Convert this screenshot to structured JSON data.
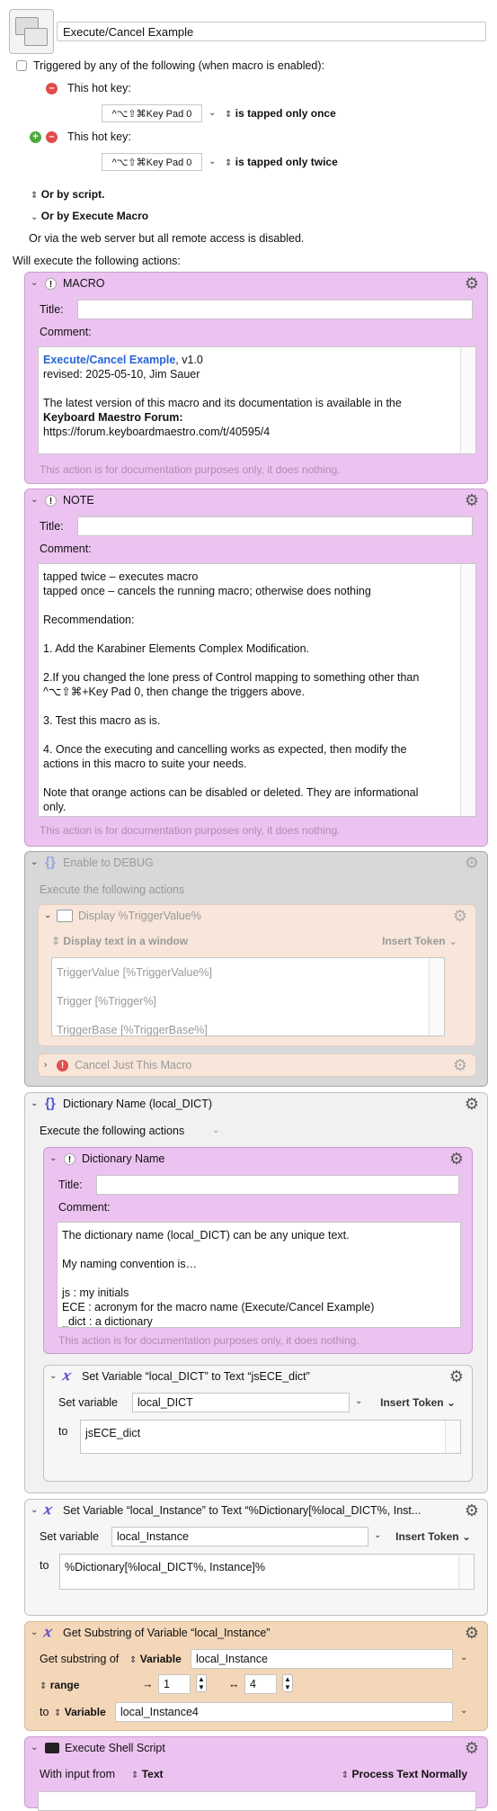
{
  "macro": {
    "name": "Execute/Cancel Example",
    "triggered_label": "Triggered by any of the following (when macro is enabled):",
    "hotkey_label": "This hot key:",
    "hotkey1": {
      "key": "^⌥⇧⌘Key Pad 0",
      "mode": "is tapped only once"
    },
    "hotkey2": {
      "key": "^⌥⇧⌘Key Pad 0",
      "mode": "is tapped only twice"
    },
    "or_by_script": "Or by script.",
    "or_by_execute": "Or by Execute Macro",
    "web_server_note": "Or via the web server but all remote access is disabled.",
    "will_execute": "Will execute the following actions:"
  },
  "labels": {
    "title": "Title:",
    "comment": "Comment:",
    "doc_footer": "This action is for documentation purposes only, it does nothing.",
    "execute_following": "Execute the following actions",
    "insert_token": "Insert Token",
    "set_variable": "Set variable",
    "to": "to"
  },
  "actions": {
    "macro_comment": {
      "header": "MACRO",
      "link": "Execute/Cancel Example",
      "version": ", v1.0",
      "revised": "revised: 2025-05-10, Jim Sauer",
      "line3": "The latest version of this macro and its documentation is available in the",
      "forum": "Keyboard Maestro Forum:",
      "url": "https://forum.keyboardmaestro.com/t/40595/4"
    },
    "note_comment": {
      "header": "NOTE",
      "lines": [
        "tapped twice – executes macro",
        "tapped once – cancels the running macro; otherwise does nothing",
        "",
        "Recommendation:",
        "",
        "1. Add the Karabiner Elements Complex Modification.",
        "",
        "2.If you changed the lone press of Control mapping to something other than",
        "^⌥⇧⌘+Key Pad 0, then change the triggers above.",
        "",
        "3. Test this macro as is.",
        "",
        "4. Once the executing and cancelling works as expected, then modify the",
        "actions in this macro to suite your needs.",
        "",
        "Note that orange actions can be disabled or deleted. They are informational",
        "only."
      ]
    },
    "debug_group": {
      "header": "Enable to DEBUG",
      "display_header": "Display %TriggerValue%",
      "display_mode": "Display text in a window",
      "lines": [
        "TriggerValue [%TriggerValue%]",
        "Trigger [%Trigger%]",
        "TriggerBase  [%TriggerBase%]"
      ],
      "cancel_header": "Cancel Just This Macro"
    },
    "dict_group": {
      "header": "Dictionary Name (local_DICT)",
      "comment_header": "Dictionary Name",
      "comment_lines": [
        "The dictionary name (local_DICT) can be any unique text.",
        "",
        "My naming convention is…",
        "",
        "js : my initials",
        "ECE : acronym for the macro name (Execute/Cancel Example)",
        "_dict : a dictionary"
      ],
      "setvar_header": "Set Variable “local_DICT” to Text “jsECE_dict”",
      "setvar_name": "local_DICT",
      "setvar_value": "jsECE_dict"
    },
    "set_instance": {
      "header": "Set Variable “local_Instance” to Text “%Dictionary[%local_DICT%, Inst...",
      "name": "local_Instance",
      "value": "%Dictionary[%local_DICT%, Instance]%"
    },
    "substring": {
      "header": "Get Substring of Variable “local_Instance”",
      "get_label": "Get substring of",
      "variable_label": "Variable",
      "source": "local_Instance",
      "range_label": "range",
      "start": "1",
      "length": "4",
      "to_label": "to",
      "dest": "local_Instance4",
      "start_arrow": "→",
      "length_arrow": "↔"
    },
    "shell": {
      "header": "Execute Shell Script",
      "input_label": "With input from",
      "input_value": "Text",
      "process_label": "Process Text Normally"
    }
  }
}
